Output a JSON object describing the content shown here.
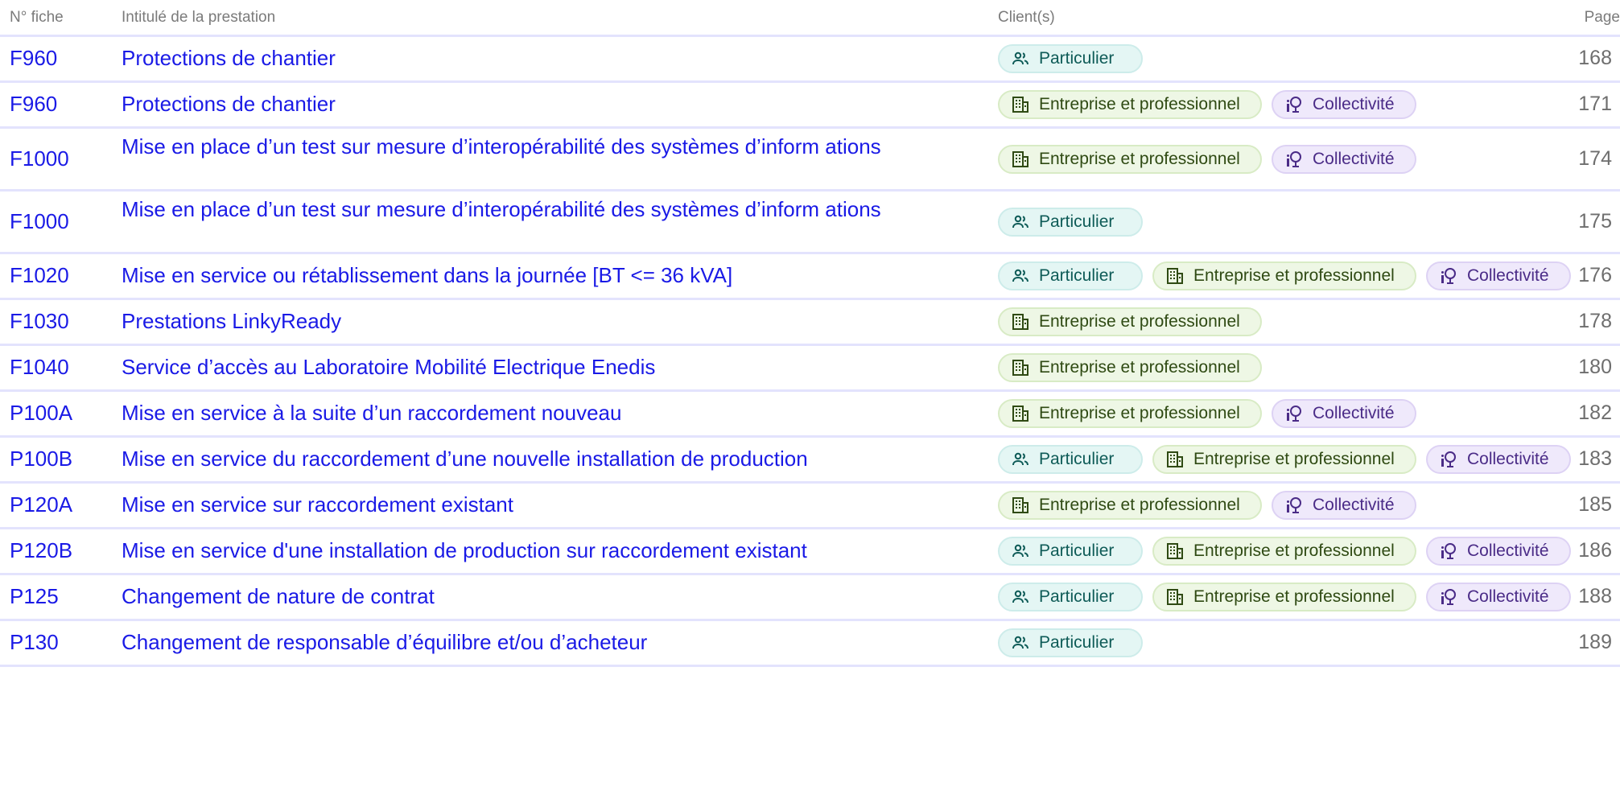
{
  "header": {
    "col_code": "N° fiche",
    "col_title": "Intitulé de la prestation",
    "col_clients": "Client(s)",
    "col_page": "Page"
  },
  "client_types": {
    "part": {
      "label": "Particulier",
      "icon": "people-icon",
      "color": "#0e5b57"
    },
    "ent": {
      "label": "Entreprise et professionnel",
      "icon": "building-icon",
      "color": "#2f4a13"
    },
    "coll": {
      "label": "Collectivité",
      "icon": "town-hall-icon",
      "color": "#4a2b87"
    }
  },
  "rows": [
    {
      "code": "F960",
      "title": "Protections de chantier",
      "clients": [
        "part"
      ],
      "page": "168"
    },
    {
      "code": "F960",
      "title": "Protections de chantier",
      "clients": [
        "ent",
        "coll"
      ],
      "page": "171"
    },
    {
      "code": "F1000",
      "title": "Mise en place d’un test sur mesure d’interopérabilité des systèmes d’inform ations",
      "clients": [
        "ent",
        "coll"
      ],
      "page": "174"
    },
    {
      "code": "F1000",
      "title": "Mise en place d’un test sur mesure d’interopérabilité des systèmes d’inform ations",
      "clients": [
        "part"
      ],
      "page": "175"
    },
    {
      "code": "F1020",
      "title": "Mise en service ou rétablissement dans la journée [BT <= 36 kVA]",
      "clients": [
        "part",
        "ent",
        "coll"
      ],
      "page": "176"
    },
    {
      "code": "F1030",
      "title": "Prestations LinkyReady",
      "clients": [
        "ent"
      ],
      "page": "178"
    },
    {
      "code": "F1040",
      "title": "Service d’accès au Laboratoire Mobilité Electrique Enedis",
      "clients": [
        "ent"
      ],
      "page": "180"
    },
    {
      "code": "P100A",
      "title": "Mise en service à la suite d’un raccordement nouveau",
      "clients": [
        "ent",
        "coll"
      ],
      "page": "182"
    },
    {
      "code": "P100B",
      "title": "Mise en service du raccordement d’une nouvelle installation de production",
      "clients": [
        "part",
        "ent",
        "coll"
      ],
      "page": "183"
    },
    {
      "code": "P120A",
      "title": "Mise en service sur raccordement existant",
      "clients": [
        "ent",
        "coll"
      ],
      "page": "185"
    },
    {
      "code": "P120B",
      "title": "Mise en service d'une installation de production sur raccordement existant",
      "clients": [
        "part",
        "ent",
        "coll"
      ],
      "page": "186"
    },
    {
      "code": "P125",
      "title": "Changement de nature de contrat",
      "clients": [
        "part",
        "ent",
        "coll"
      ],
      "page": "188"
    },
    {
      "code": "P130",
      "title": "Changement de responsable d’équilibre et/ou d’acheteur",
      "clients": [
        "part"
      ],
      "page": "189"
    }
  ]
}
